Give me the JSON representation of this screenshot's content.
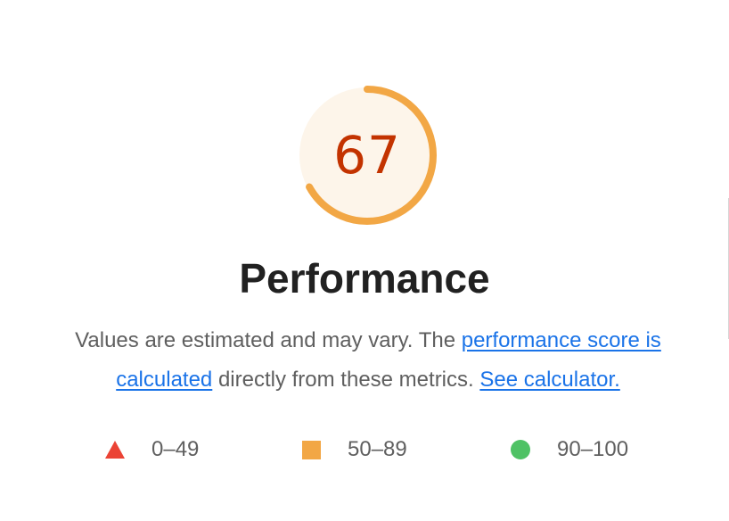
{
  "gauge": {
    "score": "67",
    "fraction": 0.67,
    "arc_color": "#f2a745",
    "fill_color": "#fdf5ea",
    "text_color": "#c33300"
  },
  "section": {
    "title": "Performance"
  },
  "description": {
    "text_before": "Values are estimated and may vary. The ",
    "link1": "performance score is calculated",
    "text_middle": " directly from these metrics. ",
    "link2": "See calculator."
  },
  "legend": [
    {
      "shape": "triangle",
      "label": "0–49",
      "color": "#eb4335"
    },
    {
      "shape": "square",
      "label": "50–89",
      "color": "#f2a745"
    },
    {
      "shape": "circle",
      "label": "90–100",
      "color": "#4fc265"
    }
  ]
}
